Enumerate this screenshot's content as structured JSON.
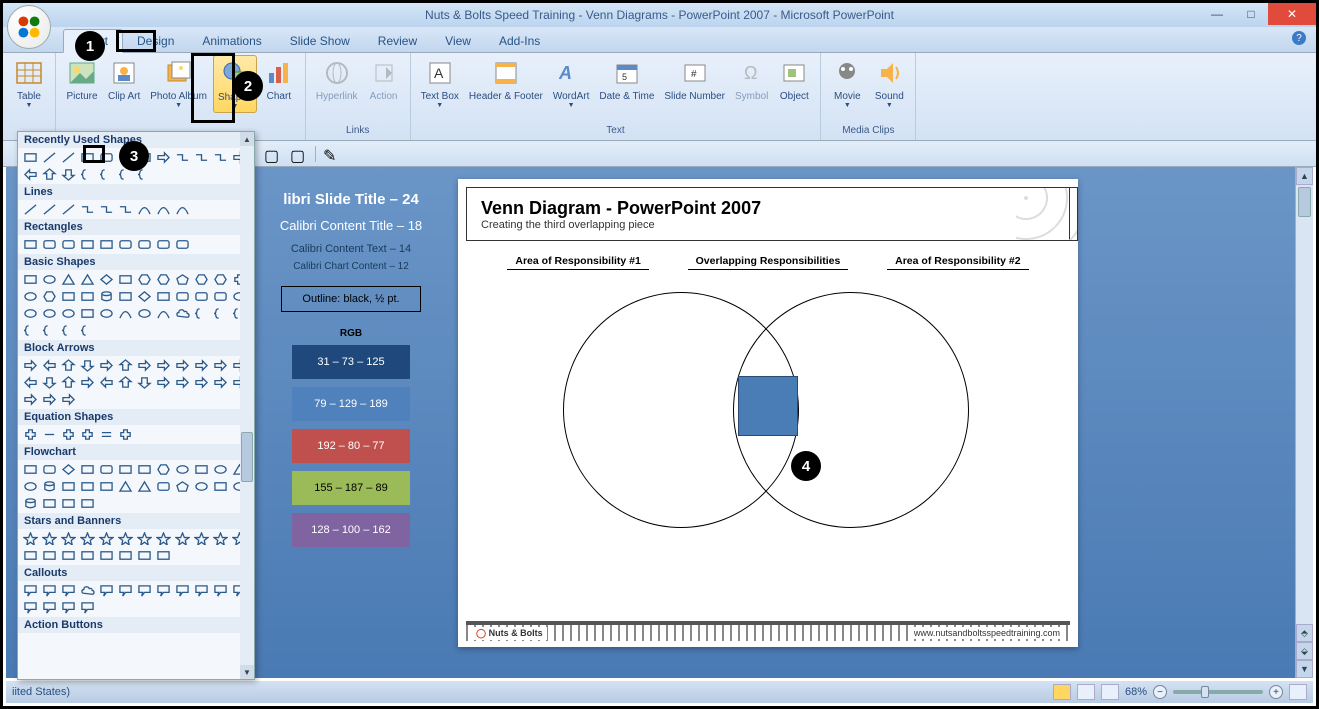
{
  "window": {
    "title": "Nuts & Bolts Speed Training - Venn Diagrams - PowerPoint 2007 - Microsoft PowerPoint"
  },
  "tabs": {
    "insert": "Insert",
    "design": "Design",
    "animations": "Animations",
    "slideshow": "Slide Show",
    "review": "Review",
    "view": "View",
    "addins": "Add-Ins"
  },
  "ribbon": {
    "table": "Table",
    "picture": "Picture",
    "clipart": "Clip Art",
    "photoalbum": "Photo Album",
    "shapes": "Shapes",
    "chart": "Chart",
    "hyperlink": "Hyperlink",
    "action": "Action",
    "textbox": "Text Box",
    "headerfooter": "Header & Footer",
    "wordart": "WordArt",
    "datetime": "Date & Time",
    "slidenumber": "Slide Number",
    "symbol": "Symbol",
    "object": "Object",
    "movie": "Movie",
    "sound": "Sound",
    "g_links": "Links",
    "g_text": "Text",
    "g_media": "Media Clips"
  },
  "shapesdd": {
    "recent": "Recently Used Shapes",
    "lines": "Lines",
    "rect": "Rectangles",
    "basic": "Basic Shapes",
    "block": "Block Arrows",
    "eq": "Equation Shapes",
    "flow": "Flowchart",
    "stars": "Stars and Banners",
    "callouts": "Callouts",
    "action": "Action Buttons"
  },
  "leftpanel": {
    "t1": "libri Slide Title – 24",
    "t2": "Calibri Content Title – 18",
    "t3": "Calibri  Content  Text – 14",
    "t4": "Calibri  Chart  Content – 12",
    "outline": "Outline: black, ½ pt.",
    "rgb": "RGB",
    "sw1": "31 – 73 – 125",
    "sw2": "79 – 129 – 189",
    "sw3": "192 – 80 – 77",
    "sw4": "155 – 187 – 89",
    "sw5": "128 – 100 – 162"
  },
  "slide": {
    "title": "Venn Diagram - PowerPoint 2007",
    "subtitle": "Creating the third overlapping  piece",
    "col1": "Area of Responsibility #1",
    "col2": "Overlapping Responsibilities",
    "col3": "Area of Responsibility #2",
    "brand": "Nuts & Bolts",
    "url": "www.nutsandboltsspeedtraining.com"
  },
  "status": {
    "lang": "iited States)",
    "zoom": "68%"
  },
  "callouts": {
    "c1": "1",
    "c2": "2",
    "c3": "3",
    "c4": "4"
  }
}
